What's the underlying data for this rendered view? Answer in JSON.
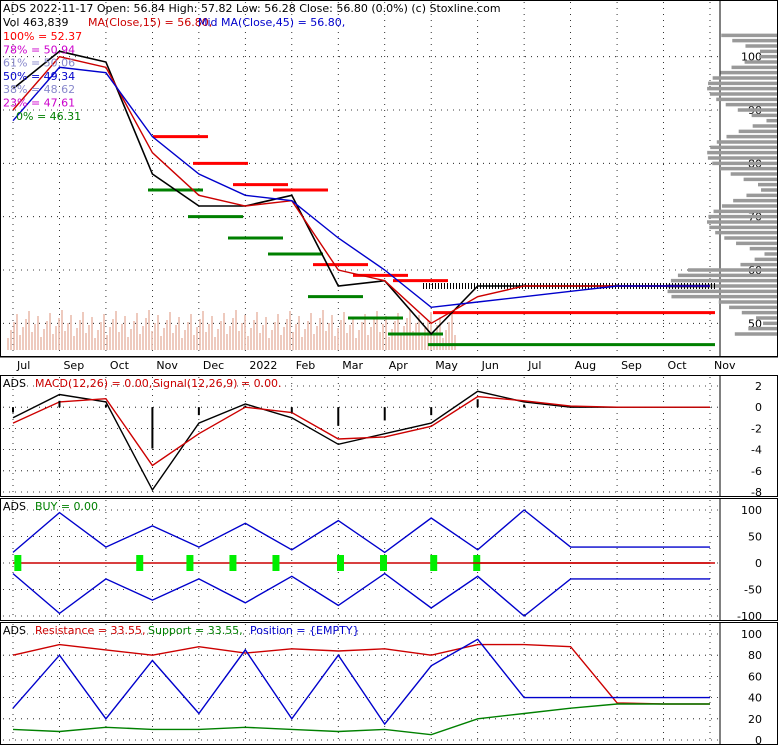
{
  "header": {
    "line1": "ADS  2022-11-17 Open: 56.84  High: 57.82  Low: 56.28  Close: 56.80 (0.0%)  (c) Stoxline.com",
    "vol": "Vol 463,839",
    "ma15": "MA(Close,15) = 56.80,",
    "ma45": "Mid MA(Close,45) = 56.80,"
  },
  "colors": {
    "price": "#000000",
    "ma15": "#cc0000",
    "ma45": "#0000cc",
    "resistance": "#ff0000",
    "support": "#008000",
    "fib": "#800080",
    "volume": "#e8b8a8",
    "histogram": "#aaaaaa",
    "buy": "#00ee00"
  },
  "fib_levels": [
    {
      "label": "100% = 52.37",
      "color": "#ff0000"
    },
    {
      "label": "78% = 50.94",
      "color": "#cc00cc"
    },
    {
      "label": "61% = 50.06",
      "color": "#8888cc"
    },
    {
      "label": "50% = 49.34",
      "color": "#0000cc"
    },
    {
      "label": "38% = 48.62",
      "color": "#8888cc"
    },
    {
      "label": "23% = 47.61",
      "color": "#cc00cc"
    },
    {
      "label": "0% = 46.31",
      "color": "#008000"
    }
  ],
  "macd": {
    "name": "ADS",
    "label": "MACD(12,26) = 0.00,",
    "signal": "Signal(12,26,9) = 0.00."
  },
  "buy": {
    "name": "ADS",
    "label": "BUY = 0.00"
  },
  "srp": {
    "name": "ADS",
    "resistance": "Resistance = 33.55,",
    "support": "Support = 33.55,",
    "position": "Position = {EMPTY}"
  },
  "chart_data": [
    {
      "type": "line",
      "title": "Price",
      "x": [
        "Jul",
        "Sep",
        "Oct",
        "Nov",
        "Dec",
        "2022",
        "Feb",
        "Mar",
        "Apr",
        "May",
        "Jun",
        "Jul",
        "Aug",
        "Sep",
        "Oct",
        "Nov"
      ],
      "ylim": [
        45,
        105
      ],
      "yticks": [
        50,
        60,
        70,
        80,
        90,
        100
      ],
      "series": [
        {
          "name": "Close",
          "values": [
            94,
            101,
            99,
            78,
            72,
            72,
            74,
            57,
            58,
            48,
            57,
            57,
            57,
            57,
            57,
            57
          ]
        },
        {
          "name": "MA(Close,15)",
          "values": [
            90,
            100,
            98,
            82,
            74,
            72,
            73,
            60,
            58,
            50,
            55,
            57,
            57,
            57,
            57,
            57
          ]
        },
        {
          "name": "Mid MA(Close,45)",
          "values": [
            88,
            98,
            97,
            85,
            78,
            74,
            73,
            66,
            60,
            53,
            54,
            55,
            56,
            57,
            57,
            57
          ]
        }
      ],
      "resistance_levels": [
        85,
        80,
        76,
        75,
        61,
        59,
        58,
        52
      ],
      "support_levels": [
        75,
        70,
        66,
        63,
        55,
        51,
        48,
        46
      ]
    },
    {
      "type": "line",
      "title": "MACD",
      "ylim": [
        -8,
        2
      ],
      "yticks": [
        2,
        0,
        -2,
        -4,
        -6,
        -8
      ],
      "series": [
        {
          "name": "MACD(12,26)",
          "values": [
            -1,
            1.2,
            0.5,
            -7.8,
            -1.5,
            0.3,
            -1.0,
            -3.5,
            -2.5,
            -1.5,
            1.5,
            0.5,
            0,
            0,
            0,
            0
          ]
        },
        {
          "name": "Signal(12,26,9)",
          "values": [
            -1.5,
            0.5,
            0.8,
            -5.5,
            -2.5,
            0,
            -0.5,
            -3.0,
            -2.8,
            -1.8,
            1.0,
            0.6,
            0.1,
            0,
            0,
            0
          ]
        }
      ]
    },
    {
      "type": "line",
      "title": "BUY",
      "ylim": [
        -100,
        100
      ],
      "yticks": [
        100,
        50,
        0,
        -50,
        -100
      ],
      "series": [
        {
          "name": "Upper",
          "values": [
            20,
            95,
            30,
            70,
            30,
            75,
            25,
            80,
            20,
            85,
            25,
            100,
            30,
            30,
            30,
            30
          ]
        },
        {
          "name": "Lower",
          "values": [
            -20,
            -95,
            -30,
            -70,
            -30,
            -75,
            -25,
            -80,
            -20,
            -85,
            -25,
            -100,
            -30,
            -30,
            -30,
            -30
          ]
        },
        {
          "name": "BUY",
          "values": [
            0,
            0,
            0,
            0,
            0,
            0,
            0,
            0,
            0,
            0,
            0,
            0,
            0,
            0,
            0,
            0
          ]
        }
      ]
    },
    {
      "type": "line",
      "title": "Resistance / Support / Position",
      "ylim": [
        0,
        100
      ],
      "yticks": [
        100,
        80,
        60,
        40,
        20,
        0
      ],
      "series": [
        {
          "name": "Resistance",
          "values": [
            80,
            90,
            85,
            80,
            88,
            82,
            86,
            84,
            86,
            80,
            90,
            90,
            88,
            35,
            34,
            34
          ]
        },
        {
          "name": "Support",
          "values": [
            10,
            8,
            12,
            10,
            10,
            12,
            10,
            8,
            10,
            5,
            20,
            25,
            30,
            34,
            34,
            34
          ]
        },
        {
          "name": "Position",
          "values": [
            30,
            80,
            20,
            75,
            25,
            85,
            20,
            80,
            15,
            70,
            95,
            40,
            40,
            40,
            40,
            40
          ]
        }
      ]
    }
  ]
}
